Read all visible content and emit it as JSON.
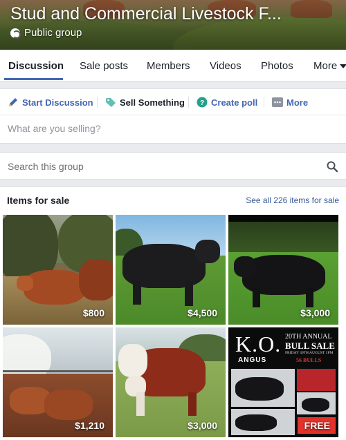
{
  "group": {
    "title": "Stud and Commercial Livestock F...",
    "privacy": "Public group"
  },
  "tabs": [
    {
      "label": "Discussion"
    },
    {
      "label": "Sale posts"
    },
    {
      "label": "Members"
    },
    {
      "label": "Videos"
    },
    {
      "label": "Photos"
    },
    {
      "label": "More"
    }
  ],
  "composer": {
    "actions": [
      {
        "label": "Start Discussion",
        "icon": "pencil-icon"
      },
      {
        "label": "Sell Something",
        "icon": "tag-icon"
      },
      {
        "label": "Create poll",
        "icon": "poll-icon"
      },
      {
        "label": "More",
        "icon": "more-icon"
      }
    ],
    "placeholder": "What are you selling?"
  },
  "search": {
    "placeholder": "Search this group"
  },
  "items_for_sale": {
    "title": "Items for sale",
    "see_all": "See all 226 items for sale",
    "items": [
      {
        "price": "$800"
      },
      {
        "price": "$4,500"
      },
      {
        "price": "$3,000"
      },
      {
        "price": "$1,210"
      },
      {
        "price": "$3,000"
      },
      {
        "price": "FREE",
        "ad": {
          "brand": "K.O.",
          "sub": "ANGUS",
          "headline1": "20TH ANNUAL",
          "headline2": "BULL SALE",
          "date": "FRIDAY 30TH AUGUST 1PM",
          "count": "56 BULLS"
        }
      }
    ]
  },
  "colors": {
    "accent": "#4267b2",
    "link": "#365899",
    "free_badge": "#e4322b"
  }
}
